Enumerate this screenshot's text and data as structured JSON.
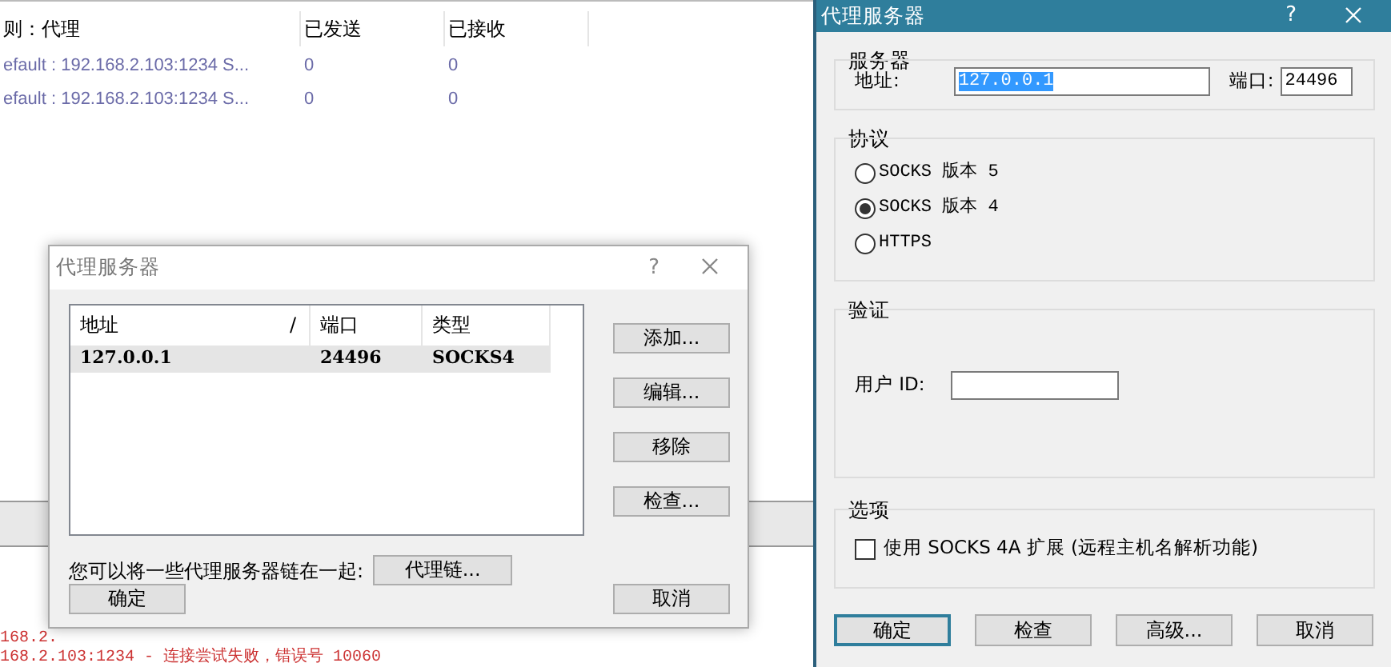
{
  "background_window": {
    "columns": [
      "则：代理",
      "已发送",
      "已接收"
    ],
    "rows": [
      {
        "rule": "efault : 192.168.2.103:1234 S...",
        "sent": "0",
        "received": "0"
      },
      {
        "rule": "efault : 192.168.2.103:1234 S...",
        "sent": "0",
        "received": "0"
      }
    ],
    "log_lines": [
      "168.2.",
      "168.2.103:1234 - 连接尝试失败，错误号 10060"
    ]
  },
  "proxy_list_dialog": {
    "title": "代理服务器",
    "help": "?",
    "columns": [
      "地址",
      "端口",
      "类型"
    ],
    "sort_mark": "/",
    "rows": [
      {
        "address": "127.0.0.1",
        "port": "24496",
        "type": "SOCKS4",
        "selected": true
      }
    ],
    "side_buttons": [
      "添加...",
      "编辑...",
      "移除",
      "检查..."
    ],
    "chain_note": "您可以将一些代理服务器链在一起:",
    "chain_button": "代理链...",
    "ok_button": "确定",
    "cancel_button": "取消"
  },
  "proxy_server_dialog": {
    "title": "代理服务器",
    "help": "?",
    "server": {
      "legend": "服务器",
      "address_label": "地址:",
      "address_value": "127.0.0.1",
      "address_text_selected": true,
      "port_label": "端口:",
      "port_value": "24496"
    },
    "protocol": {
      "legend": "协议",
      "options": [
        {
          "label": "SOCKS 版本 5",
          "selected": false
        },
        {
          "label": "SOCKS 版本 4",
          "selected": true
        },
        {
          "label": "HTTPS",
          "selected": false
        }
      ]
    },
    "auth": {
      "legend": "验证",
      "user_id_label": "用户 ID:"
    },
    "options": {
      "legend": "选项",
      "label": "使用 SOCKS 4A 扩展 (远程主机名解析功能)",
      "checked": false
    },
    "buttons": [
      {
        "label": "确定",
        "focused": true
      },
      {
        "label": "检查",
        "focused": false
      },
      {
        "label": "高级...",
        "focused": false
      },
      {
        "label": "取消",
        "focused": false
      }
    ]
  }
}
